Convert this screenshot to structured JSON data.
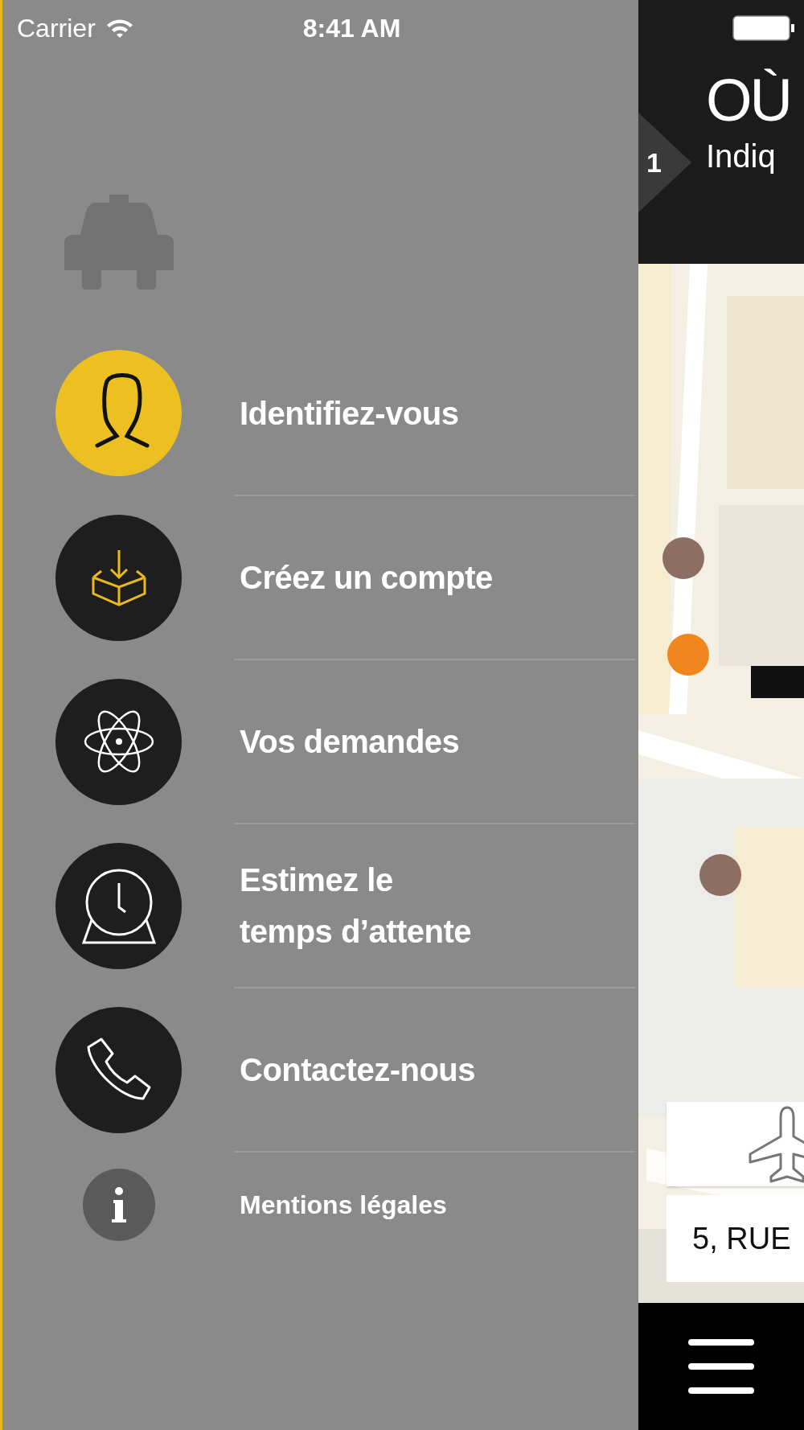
{
  "status_bar": {
    "carrier": "Carrier",
    "time": "8:41 AM"
  },
  "drawer": {
    "items": [
      {
        "label": "Identifiez-vous",
        "selected": true
      },
      {
        "label": "Créez un compte",
        "selected": false
      },
      {
        "label": "Vos demandes",
        "selected": false
      },
      {
        "label": "Estimez le\ntemps d’attente",
        "selected": false
      },
      {
        "label": "Contactez-nous",
        "selected": false
      }
    ],
    "legal": "Mentions légales"
  },
  "main": {
    "step": "1",
    "title": "OÙ",
    "subtitle": "Indiq",
    "address": "5, RUE"
  }
}
